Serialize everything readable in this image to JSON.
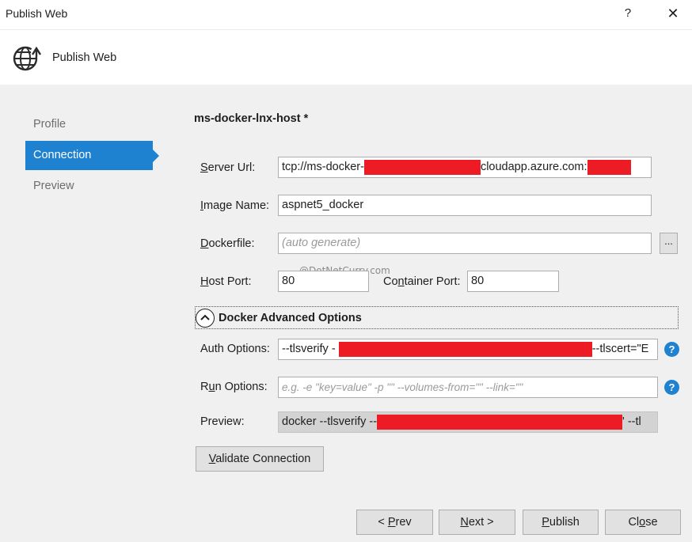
{
  "window": {
    "title": "Publish Web",
    "help": "?",
    "close": "✕"
  },
  "header": {
    "title": "Publish Web",
    "icon": "globe-publish-icon"
  },
  "nav": {
    "items": [
      {
        "label": "Profile"
      },
      {
        "label": "Connection"
      },
      {
        "label": "Preview"
      }
    ]
  },
  "profile_name": "ms-docker-lnx-host *",
  "fields": {
    "server_url": {
      "label": "Server Url:",
      "value_prefix": "tcp://ms-docker-",
      "value_mid": "cloudapp.azure.com:"
    },
    "image_name": {
      "label": "Image Name:",
      "value": "aspnet5_docker"
    },
    "dockerfile": {
      "label": "Dockerfile:",
      "placeholder": "(auto generate)",
      "browse": "..."
    },
    "host_port": {
      "label": "Host Port:",
      "value": "80"
    },
    "container_port": {
      "label": "Container Port:",
      "value": "80"
    }
  },
  "watermark": "@DotNetCurry.com",
  "advanced": {
    "title": "Docker Advanced Options",
    "auth": {
      "label": "Auth Options:",
      "value_prefix": "--tlsverify -",
      "value_suffix": "--tlscert=\"E"
    },
    "run": {
      "label": "Run Options:",
      "placeholder": "e.g. -e \"key=value\" -p \"\" --volumes-from=\"\" --link=\"\""
    },
    "preview": {
      "label": "Preview:",
      "value_prefix": "docker --tlsverify --",
      "value_suffix": "' --tl"
    },
    "help_icon": "?"
  },
  "validate_button": "Validate Connection",
  "footer": {
    "prev": "< Prev",
    "next": "Next >",
    "publish": "Publish",
    "close": "Close"
  },
  "colors": {
    "accent": "#1e82d0",
    "redaction": "#ed1c24",
    "panel_bg": "#f0f0f0"
  }
}
